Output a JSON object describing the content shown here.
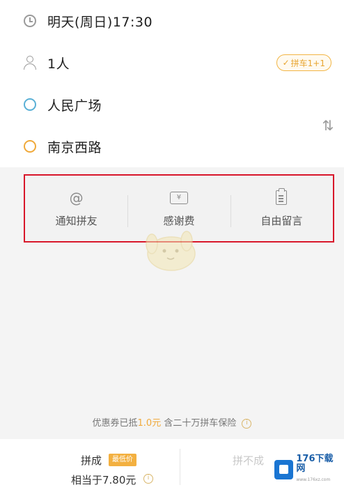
{
  "trip": {
    "time": "明天(周日)17:30",
    "passengers": "1人",
    "carpool_badge": "拼车1+1",
    "origin": "人民广场",
    "destination": "南京西路"
  },
  "options": [
    {
      "label": "通知拼友",
      "icon": "at-icon"
    },
    {
      "label": "感谢费",
      "icon": "ticket-icon"
    },
    {
      "label": "自由留言",
      "icon": "clipboard-icon"
    }
  ],
  "coupon_hint": {
    "prefix": "优惠券已抵",
    "amount": "1.0元",
    "suffix": " 含二十万拼车保险"
  },
  "bottom": {
    "success_label": "拼成",
    "success_tag": "最低价",
    "success_price": "相当于7.80元",
    "fail_label": "拼不成"
  },
  "watermark": {
    "text": "176下载网",
    "sub": "www.176xz.com"
  },
  "colors": {
    "highlight": "#d8162a",
    "accent": "#f0a93a",
    "origin_dot": "#5ab0d6",
    "destination_dot": "#f0a93a"
  }
}
